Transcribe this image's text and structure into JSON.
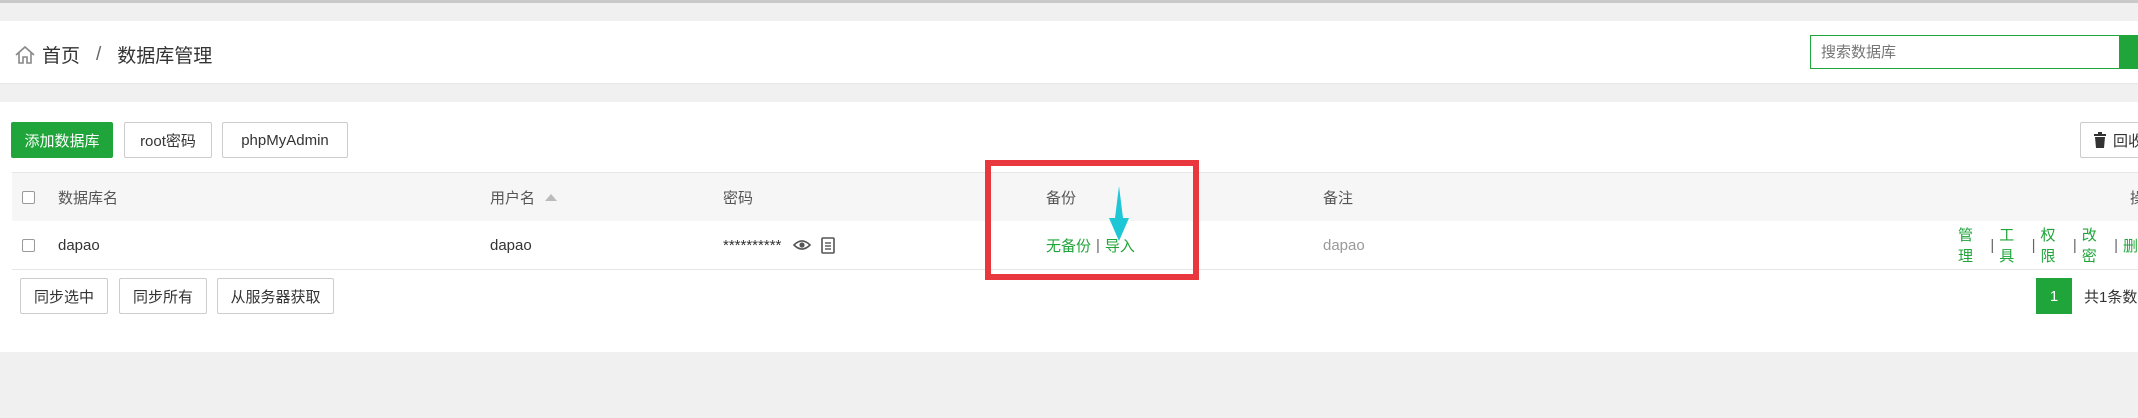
{
  "breadcrumb": {
    "home": "首页",
    "separator": "/",
    "current": "数据库管理"
  },
  "search": {
    "placeholder": "搜索数据库"
  },
  "toolbar": {
    "add_database": "添加数据库",
    "root_password": "root密码",
    "phpmyadmin": "phpMyAdmin",
    "recycle": "回收"
  },
  "table": {
    "headers": {
      "name": "数据库名",
      "username": "用户名",
      "password": "密码",
      "backup": "备份",
      "note": "备注",
      "ops": "操"
    },
    "rows": [
      {
        "name": "dapao",
        "username": "dapao",
        "password": "**********",
        "backup_status": "无备份",
        "import": "导入",
        "note": "dapao",
        "ops": [
          "管理",
          "工具",
          "权限",
          "改密",
          "删"
        ]
      }
    ]
  },
  "footer": {
    "sync_selected": "同步选中",
    "sync_all": "同步所有",
    "fetch_from_server": "从服务器获取",
    "current_page": "1",
    "total": "共1条数"
  },
  "colors": {
    "brand_green": "#20a53a",
    "highlight_red": "#e8383d",
    "arrow_cyan": "#1fc6d6"
  }
}
